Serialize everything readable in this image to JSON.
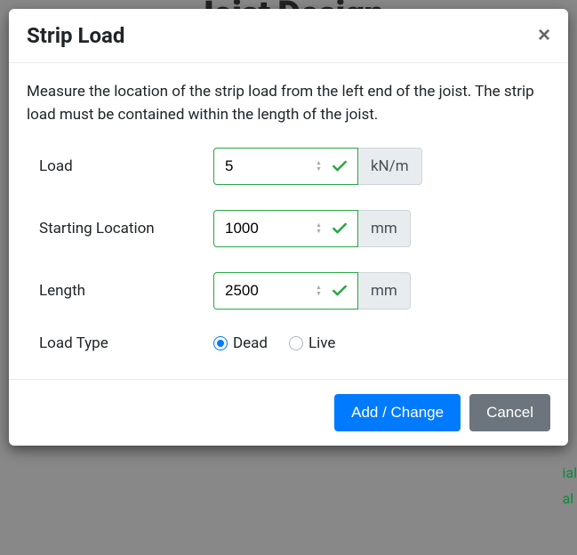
{
  "background": {
    "title": "Joist Design",
    "sideText1": "ial",
    "sideText2": "al"
  },
  "modal": {
    "title": "Strip Load",
    "description": "Measure the location of the strip load from the left end of the joist. The strip load must be contained within the length of the joist.",
    "fields": {
      "load": {
        "label": "Load",
        "value": "5",
        "unit": "kN/m"
      },
      "startingLocation": {
        "label": "Starting Location",
        "value": "1000",
        "unit": "mm"
      },
      "length": {
        "label": "Length",
        "value": "2500",
        "unit": "mm"
      },
      "loadType": {
        "label": "Load Type",
        "options": {
          "dead": "Dead",
          "live": "Live"
        },
        "selected": "dead"
      }
    },
    "buttons": {
      "submit": "Add / Change",
      "cancel": "Cancel"
    }
  }
}
